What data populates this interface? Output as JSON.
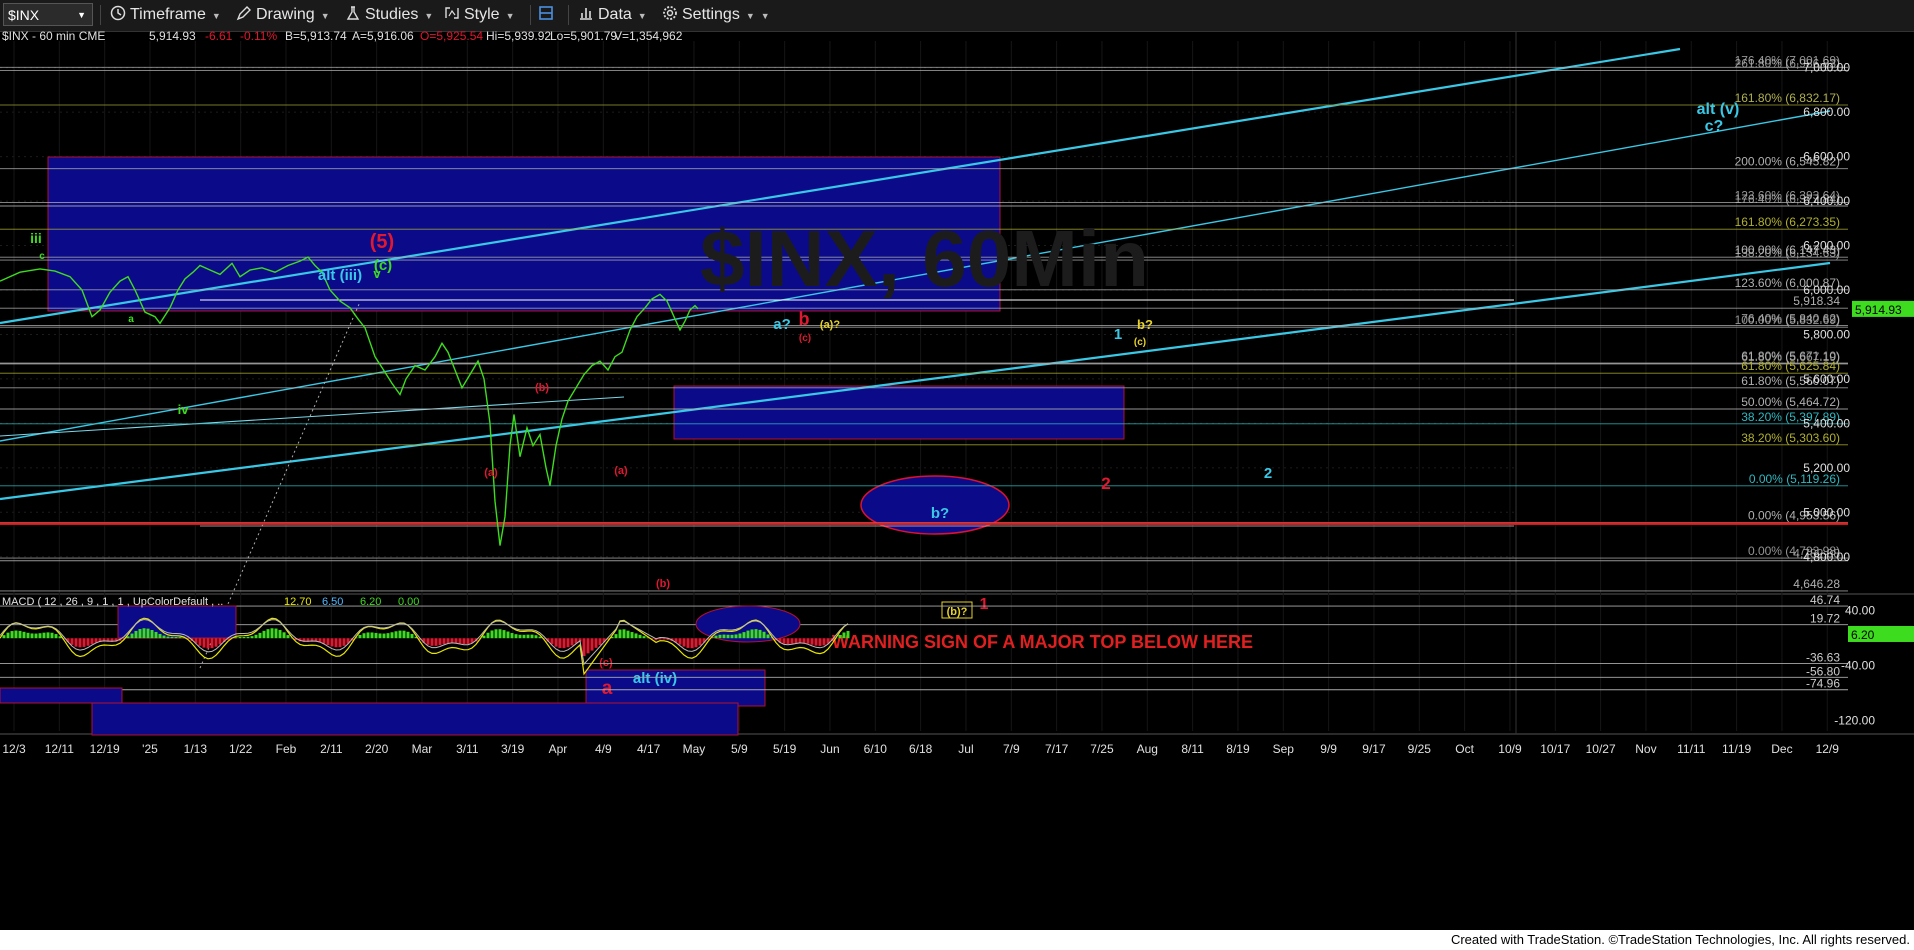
{
  "toolbar": {
    "symbol": "$INX",
    "timeframe": "Timeframe",
    "drawing": "Drawing",
    "studies": "Studies",
    "style": "Style",
    "data": "Data",
    "settings": "Settings"
  },
  "footer": "Created with TradeStation. ©TradeStation Technologies, Inc. All rights reserved.",
  "chart_data": {
    "type": "line",
    "quote": {
      "symbol": "$INX - 60 min CME",
      "last": "5,914.93",
      "change": "-6.61",
      "pct": "-0.11%",
      "bid": "B=5,913.74",
      "ask": "A=5,916.06",
      "open": "O=5,925.54",
      "high": "Hi=5,939.92",
      "low": "Lo=5,901.79",
      "volume": "V=1,354,962"
    },
    "last_price": 5914.93,
    "last_label": "5,914.93",
    "ylim": [
      4646,
      7120
    ],
    "y_ticks": [
      "4,800.00",
      "5,000.00",
      "5,200.00",
      "5,400.00",
      "5,600.00",
      "5,800.00",
      "6,000.00",
      "6,200.00",
      "6,400.00",
      "6,600.00",
      "6,800.00",
      "7,000.00"
    ],
    "x_ticks": [
      "12/3",
      "12/11",
      "12/19",
      "'25",
      "1/13",
      "1/22",
      "Feb",
      "2/11",
      "2/20",
      "Mar",
      "3/11",
      "3/19",
      "Apr",
      "4/9",
      "4/17",
      "May",
      "5/9",
      "5/19",
      "Jun",
      "6/10",
      "6/18",
      "Jul",
      "7/9",
      "7/17",
      "7/25",
      "Aug",
      "8/11",
      "8/19",
      "Sep",
      "9/9",
      "9/17",
      "9/25",
      "Oct",
      "10/9",
      "10/17",
      "10/27",
      "Nov",
      "11/11",
      "11/19",
      "Dec",
      "12/9"
    ],
    "series": [
      {
        "color": "#3ddc1e",
        "points": [
          [
            0,
            6040
          ],
          [
            20,
            6080
          ],
          [
            40,
            6095
          ],
          [
            55,
            6085
          ],
          [
            70,
            6060
          ],
          [
            82,
            6000
          ],
          [
            92,
            5880
          ],
          [
            100,
            5910
          ],
          [
            110,
            5990
          ],
          [
            120,
            6040
          ],
          [
            128,
            6060
          ],
          [
            135,
            6000
          ],
          [
            145,
            5900
          ],
          [
            155,
            5880
          ],
          [
            160,
            5850
          ],
          [
            170,
            5920
          ],
          [
            178,
            6000
          ],
          [
            185,
            6050
          ],
          [
            193,
            6080
          ],
          [
            200,
            6110
          ],
          [
            210,
            6090
          ],
          [
            220,
            6070
          ],
          [
            232,
            6120
          ],
          [
            240,
            6060
          ],
          [
            250,
            6090
          ],
          [
            262,
            6100
          ],
          [
            275,
            6080
          ],
          [
            288,
            6110
          ],
          [
            300,
            6130
          ],
          [
            308,
            6148
          ],
          [
            315,
            6110
          ],
          [
            322,
            6080
          ],
          [
            330,
            6000
          ],
          [
            340,
            5950
          ],
          [
            350,
            5920
          ],
          [
            358,
            5870
          ],
          [
            365,
            5830
          ],
          [
            375,
            5700
          ],
          [
            385,
            5630
          ],
          [
            392,
            5580
          ],
          [
            400,
            5530
          ],
          [
            406,
            5600
          ],
          [
            415,
            5660
          ],
          [
            425,
            5640
          ],
          [
            435,
            5700
          ],
          [
            442,
            5760
          ],
          [
            448,
            5720
          ],
          [
            455,
            5640
          ],
          [
            462,
            5560
          ],
          [
            470,
            5620
          ],
          [
            478,
            5680
          ],
          [
            484,
            5600
          ],
          [
            490,
            5400
          ],
          [
            495,
            5050
          ],
          [
            500,
            4850
          ],
          [
            505,
            4980
          ],
          [
            510,
            5300
          ],
          [
            514,
            5440
          ],
          [
            520,
            5250
          ],
          [
            527,
            5380
          ],
          [
            533,
            5300
          ],
          [
            540,
            5350
          ],
          [
            546,
            5200
          ],
          [
            550,
            5120
          ],
          [
            556,
            5300
          ],
          [
            562,
            5420
          ],
          [
            568,
            5500
          ],
          [
            576,
            5560
          ],
          [
            584,
            5620
          ],
          [
            592,
            5660
          ],
          [
            600,
            5680
          ],
          [
            608,
            5640
          ],
          [
            615,
            5700
          ],
          [
            622,
            5720
          ],
          [
            630,
            5820
          ],
          [
            637,
            5880
          ],
          [
            645,
            5920
          ],
          [
            652,
            5960
          ],
          [
            660,
            5980
          ],
          [
            667,
            5950
          ],
          [
            674,
            5880
          ],
          [
            680,
            5820
          ],
          [
            685,
            5860
          ],
          [
            690,
            5910
          ],
          [
            695,
            5930
          ],
          [
            698,
            5915
          ]
        ]
      }
    ],
    "fib_levels": [
      {
        "label": "161.80% (6,832.17)",
        "color": "#8c8c2c",
        "value": 6832.17
      },
      {
        "label": "200.00% (6,545.82)",
        "color": "#b0b0b0",
        "value": 6545.82
      },
      {
        "label": "161.80% (6,273.35)",
        "color": "#b0b030",
        "value": 6273.35
      },
      {
        "label": "100.00% (6,147.43)",
        "color": "#b0b0b0",
        "value": 6147.43
      },
      {
        "label": "123.60% (6,000.87)",
        "color": "#b0b0b0",
        "value": 6000.87
      },
      {
        "label": "5,918.34",
        "color": "#b0b0b0",
        "value": 5918.34
      },
      {
        "label": "61.80% (5,625.84)",
        "color": "#b0b030",
        "value": 5625.84
      },
      {
        "label": "61.80% (5,560.07)",
        "color": "#b0b0b0",
        "value": 5560.07
      },
      {
        "label": "50.00% (5,464.72)",
        "color": "#b0b0b0",
        "value": 5464.72
      },
      {
        "label": "38.20% (5,397.89)",
        "color": "#2fb8c0",
        "value": 5397.89
      },
      {
        "label": "38.20% (5,303.60)",
        "color": "#b0b030",
        "value": 5303.6
      },
      {
        "label": "0.00% (5,119.26)",
        "color": "#2fb8c0",
        "value": 5119.26
      },
      {
        "label": "0.00% (4,953.56)",
        "color": "#b0b0b0",
        "value": 4953.56
      },
      {
        "label": "4,646.28",
        "color": "#b0b0b0",
        "value": 4646.28
      }
    ],
    "overlapping_labels": [
      {
        "label": "176.40% (7,001.69)",
        "value": 7001.69
      },
      {
        "label": "261.80% (6,986.83)",
        "value": 6986.83
      },
      {
        "label": "123.60% (6,393.64)",
        "value": 6393.64
      },
      {
        "label": "176.40% (6,377.84)",
        "value": 6377.84
      },
      {
        "label": "138.20% (6,134.63)",
        "value": 6134.63
      },
      {
        "label": "76.40% (5,840.62)",
        "value": 5840.62
      },
      {
        "label": "100.00% (5,832.69)",
        "value": 5832.69
      },
      {
        "label": "61.80% (5,671.10)",
        "value": 5671.1
      },
      {
        "label": "61.80% (5,667.19)",
        "value": 5667.19
      },
      {
        "label": "0.00% (4,793.98)",
        "value": 4793.98
      },
      {
        "label": "4,782.08",
        "value": 4782.08
      }
    ],
    "wave_labels": {
      "green": [
        "iii",
        "c",
        "v",
        "iv",
        "(c)",
        "a"
      ],
      "red": [
        "(5)",
        "b",
        "(c)",
        "(b)",
        "(a)",
        "(a)",
        "(b)",
        "(c)",
        "a",
        "2",
        "1"
      ],
      "cyan": [
        "alt (iii)",
        "a?",
        "1",
        "2",
        "b?",
        "alt (iv)",
        "alt (v)",
        "c?"
      ],
      "yellow": [
        "(a)?",
        "b?",
        "(c)",
        "(b)?"
      ]
    },
    "warning": "WARNING SIGN OF A MAJOR TOP BELOW HERE",
    "watermark": "$INX, 60Min",
    "macd": {
      "title": "MACD ( 12 , 26 , 9 , 1 , 1 , UpColorDefault , ..",
      "values": [
        "12.70",
        "6.50",
        "6.20",
        "0.00"
      ],
      "value_colors": [
        "#e6e600",
        "#4db8ff",
        "#3ddc1e",
        "#3ddc1e"
      ],
      "ylim": [
        -135,
        60
      ],
      "y_ticks": [
        40,
        -40,
        -120
      ],
      "levels": [
        46.74,
        19.72,
        -36.63,
        -56.8,
        -74.96
      ],
      "level_labels": [
        "46.74",
        "19.72",
        "-36.63",
        "-56.80",
        "-74.96"
      ],
      "current": 6.2,
      "current_label": "6.20"
    }
  }
}
